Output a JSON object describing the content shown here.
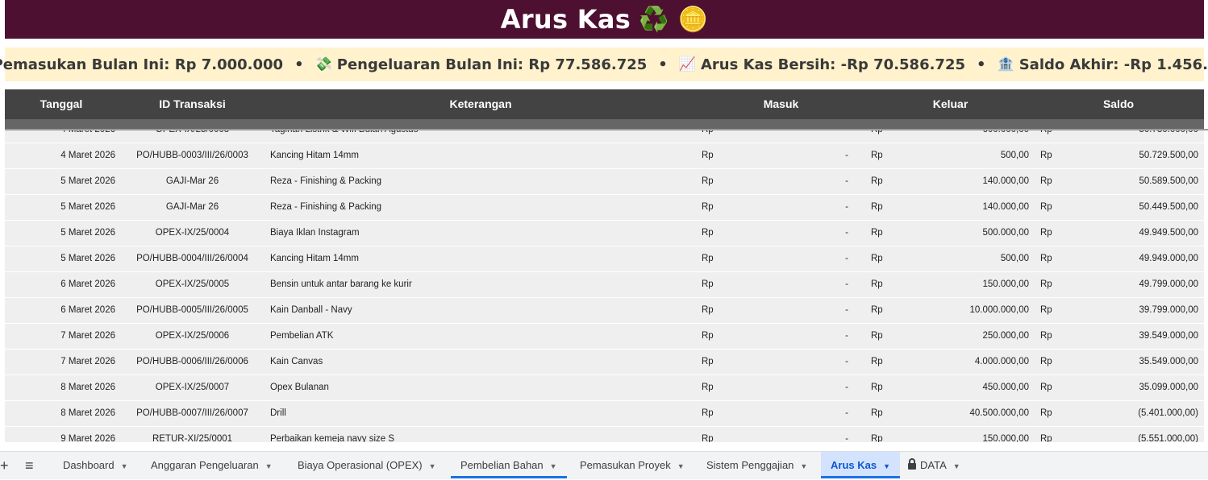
{
  "title": {
    "text": "Arus Kas",
    "emoji": "♻️ 🪙"
  },
  "summary": [
    {
      "icon": "💰",
      "label": "Pemasukan Bulan Ini:",
      "value": "Rp 7.000.000"
    },
    {
      "icon": "💸",
      "label": "Pengeluaran Bulan Ini:",
      "value": "Rp 77.586.725"
    },
    {
      "icon": "📈",
      "label": "Arus Kas Bersih:",
      "value": "-Rp 70.586.725"
    },
    {
      "icon": "🏦",
      "label": "Saldo Akhir:",
      "value": "-Rp 1.456.725"
    }
  ],
  "summary_separator": "•",
  "columns": [
    "Tanggal",
    "ID Transaksi",
    "Keterangan",
    "Masuk",
    "Keluar",
    "Saldo"
  ],
  "currency": "Rp",
  "rows": [
    {
      "date": "4 Maret 2026",
      "id": "OPEX-IX/25/0003",
      "desc": "Tagihan Listrik & Wifi Bulan Agustus",
      "in": "-",
      "out": "600.000,00",
      "bal": "50.730.000,00"
    },
    {
      "date": "4 Maret 2026",
      "id": "PO/HUBB-0003/III/26/0003",
      "desc": "Kancing Hitam 14mm",
      "in": "-",
      "out": "500,00",
      "bal": "50.729.500,00"
    },
    {
      "date": "5 Maret 2026",
      "id": "GAJI-Mar 26",
      "desc": "Reza - Finishing & Packing",
      "in": "-",
      "out": "140.000,00",
      "bal": "50.589.500,00"
    },
    {
      "date": "5 Maret 2026",
      "id": "GAJI-Mar 26",
      "desc": "Reza - Finishing & Packing",
      "in": "-",
      "out": "140.000,00",
      "bal": "50.449.500,00"
    },
    {
      "date": "5 Maret 2026",
      "id": "OPEX-IX/25/0004",
      "desc": "Biaya Iklan Instagram",
      "in": "-",
      "out": "500.000,00",
      "bal": "49.949.500,00"
    },
    {
      "date": "5 Maret 2026",
      "id": "PO/HUBB-0004/III/26/0004",
      "desc": "Kancing Hitam 14mm",
      "in": "-",
      "out": "500,00",
      "bal": "49.949.000,00"
    },
    {
      "date": "6 Maret 2026",
      "id": "OPEX-IX/25/0005",
      "desc": "Bensin untuk antar barang ke kurir",
      "in": "-",
      "out": "150.000,00",
      "bal": "49.799.000,00"
    },
    {
      "date": "6 Maret 2026",
      "id": "PO/HUBB-0005/III/26/0005",
      "desc": "Kain Danball - Navy",
      "in": "-",
      "out": "10.000.000,00",
      "bal": "39.799.000,00"
    },
    {
      "date": "7 Maret 2026",
      "id": "OPEX-IX/25/0006",
      "desc": "Pembelian ATK",
      "in": "-",
      "out": "250.000,00",
      "bal": "39.549.000,00"
    },
    {
      "date": "7 Maret 2026",
      "id": "PO/HUBB-0006/III/26/0006",
      "desc": "Kain Canvas",
      "in": "-",
      "out": "4.000.000,00",
      "bal": "35.549.000,00"
    },
    {
      "date": "8 Maret 2026",
      "id": "OPEX-IX/25/0007",
      "desc": "Opex Bulanan",
      "in": "-",
      "out": "450.000,00",
      "bal": "35.099.000,00"
    },
    {
      "date": "8 Maret 2026",
      "id": "PO/HUBB-0007/III/26/0007",
      "desc": "Drill",
      "in": "-",
      "out": "40.500.000,00",
      "bal": "(5.401.000,00)"
    },
    {
      "date": "9 Maret 2026",
      "id": "RETUR-XI/25/0001",
      "desc": "Perbaikan kemeja navy size S",
      "in": "-",
      "out": "150.000,00",
      "bal": "(5.551.000,00)"
    }
  ],
  "tabbar": {
    "add_icon": "+",
    "menu_icon": "≡",
    "tabs": [
      {
        "label": "Dashboard"
      },
      {
        "label": "Anggaran Pengeluaran"
      },
      {
        "label": "Biaya Operasional (OPEX)"
      },
      {
        "label": "Pembelian Bahan"
      },
      {
        "label": "Pemasukan Proyek"
      },
      {
        "label": "Sistem Penggajian"
      },
      {
        "label": "Arus Kas"
      },
      {
        "label": "DATA"
      }
    ]
  }
}
